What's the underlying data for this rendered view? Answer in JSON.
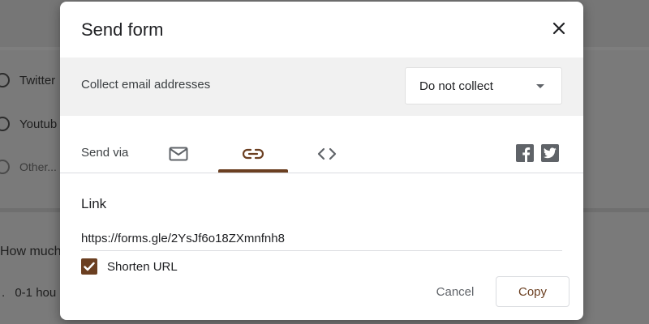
{
  "background": {
    "options": [
      "Twitter",
      "Youtub",
      "Other..."
    ],
    "question": "How much",
    "answer_prefix": ".",
    "answer": "0-1 hou"
  },
  "dialog": {
    "title": "Send form",
    "close_icon": "close-icon",
    "collect": {
      "label": "Collect email addresses",
      "selected": "Do not collect"
    },
    "send_via": {
      "label": "Send via",
      "tabs": [
        {
          "icon": "mail-icon",
          "active": false
        },
        {
          "icon": "link-icon",
          "active": true
        },
        {
          "icon": "embed-code-icon",
          "active": false
        }
      ],
      "social": [
        "facebook-icon",
        "twitter-icon"
      ]
    },
    "link": {
      "heading": "Link",
      "url": "https://forms.gle/2YsJf6o18ZXmnfnh8",
      "shorten_label": "Shorten URL",
      "shorten_checked": true
    },
    "actions": {
      "cancel": "Cancel",
      "copy": "Copy"
    }
  },
  "colors": {
    "accent": "#6b3f21",
    "overlay": "#7e7e7e"
  }
}
